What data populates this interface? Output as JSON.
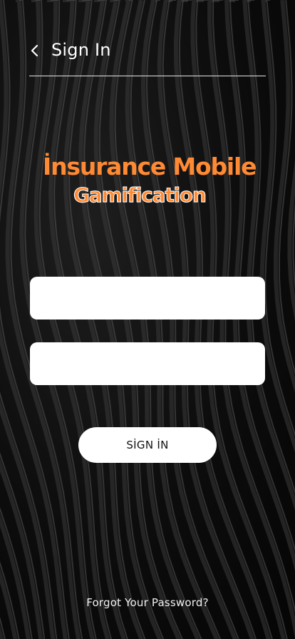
{
  "header": {
    "title": "Sign In",
    "back_icon": "chevron-left-icon"
  },
  "brand": {
    "line1": "İnsurance Mobile",
    "line2": "Gamification",
    "color": "#ff8a33"
  },
  "form": {
    "username": {
      "value": "",
      "placeholder": ""
    },
    "password": {
      "value": "",
      "placeholder": ""
    },
    "submit_label": "SİGN İN"
  },
  "forgot_password_label": "Forgot Your Password?",
  "colors": {
    "background": "#0a0a0a",
    "accent": "#ff8a33",
    "field": "#ffffff"
  }
}
